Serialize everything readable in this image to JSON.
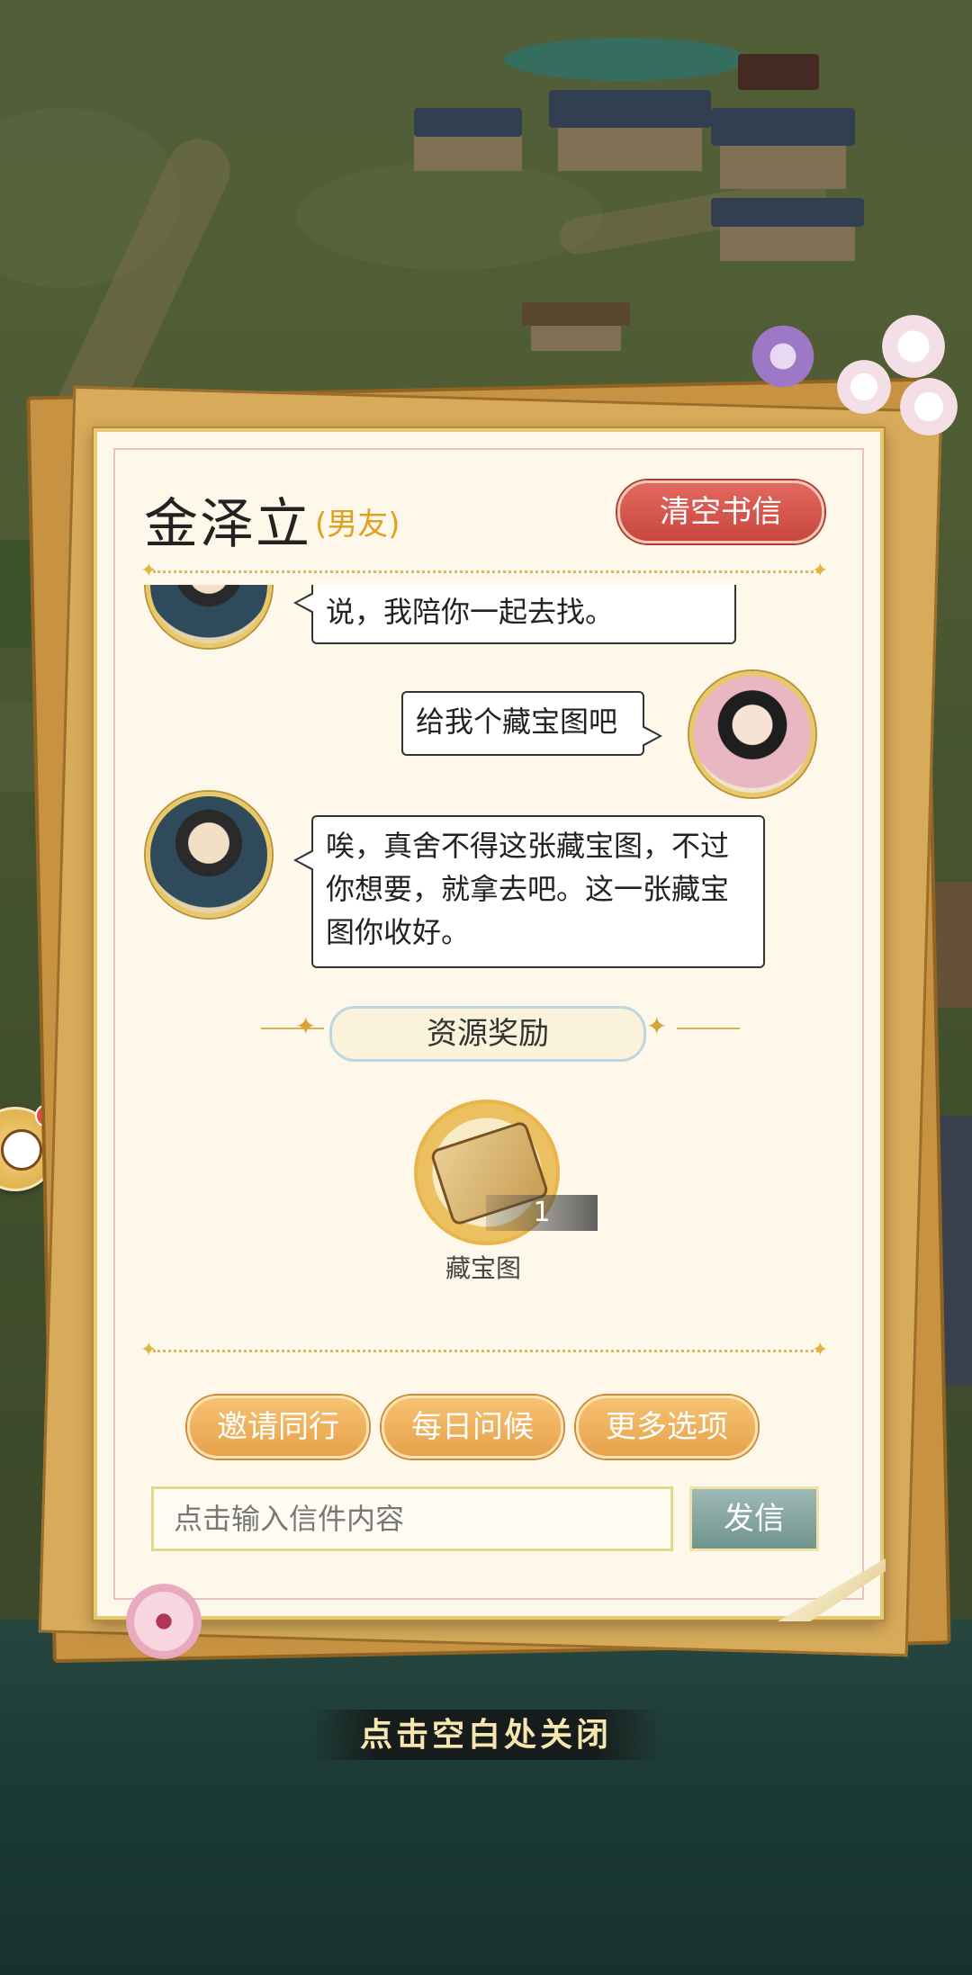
{
  "header": {
    "name": "金泽立",
    "relation": "(男友)",
    "clear_button": "清空书信"
  },
  "messages": [
    {
      "side": "left",
      "speaker": "npc",
      "text_lines": [
        "说，我陪你一起去找。"
      ]
    },
    {
      "side": "right",
      "speaker": "player",
      "text_lines": [
        "给我个藏宝图吧"
      ]
    },
    {
      "side": "left",
      "speaker": "npc",
      "text_lines": [
        "唉，真舍不得这张藏宝图，不过",
        "你想要，就拿去吧。这一张藏宝",
        "图你收好。"
      ]
    }
  ],
  "reward": {
    "title": "资源奖励",
    "item_name": "藏宝图",
    "item_count": "1",
    "item_icon": "treasure-map-scroll-icon"
  },
  "options": {
    "invite": "邀请同行",
    "greet": "每日问候",
    "more": "更多选项"
  },
  "composer": {
    "placeholder": "点击输入信件内容",
    "send": "发信"
  },
  "close_hint": "点击空白处关闭"
}
